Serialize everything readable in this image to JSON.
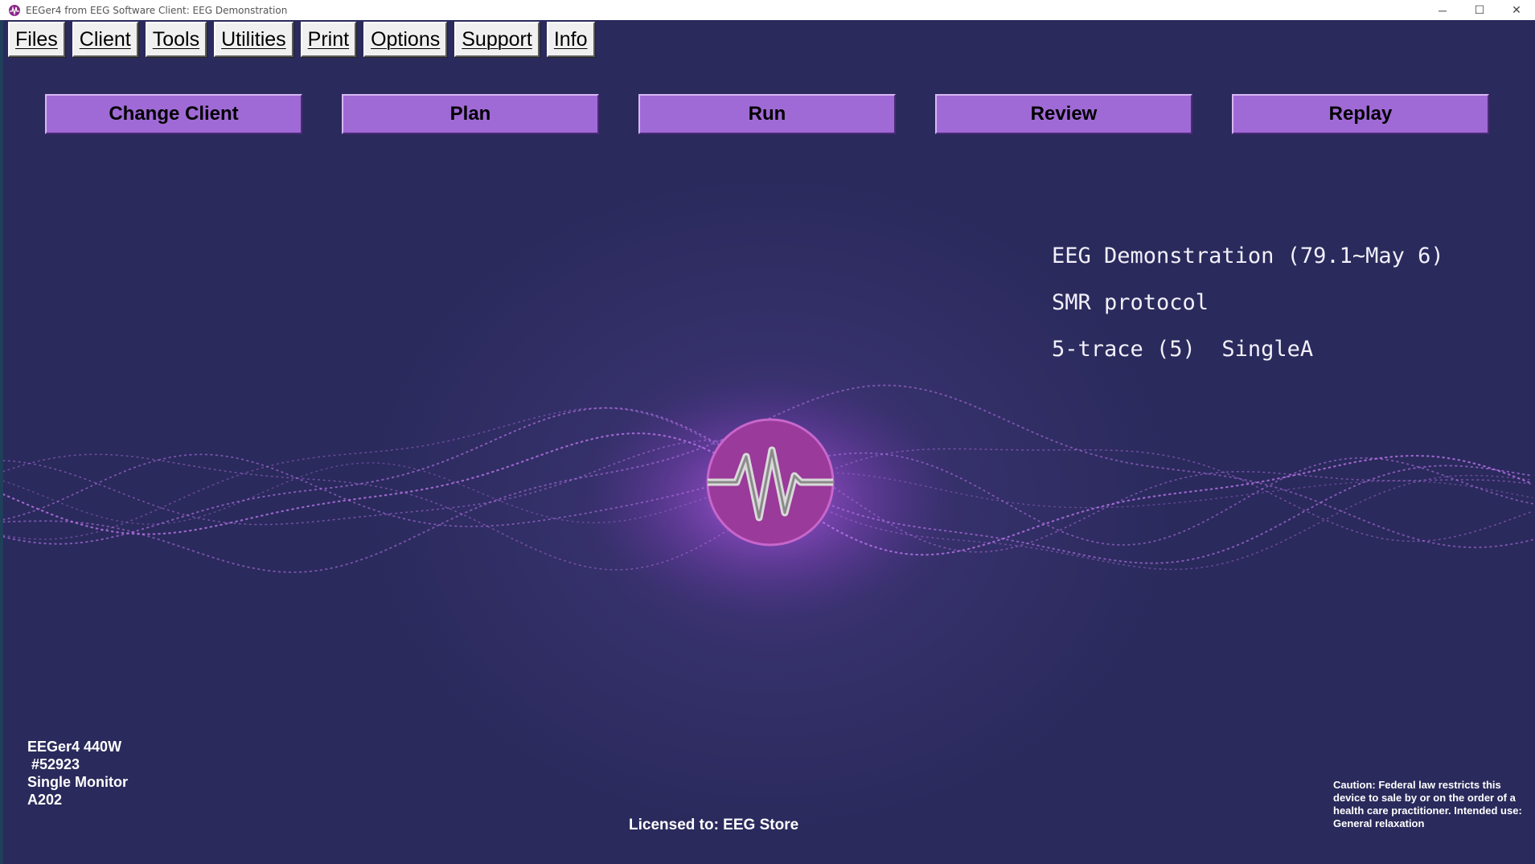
{
  "window": {
    "title": "EEGer4 from EEG Software  Client: EEG Demonstration",
    "minimize": "─",
    "maximize": "☐",
    "close": "✕"
  },
  "menu": [
    "Files",
    "Client",
    "Tools",
    "Utilities",
    "Print",
    "Options",
    "Support",
    "Info"
  ],
  "actions": [
    "Change Client",
    "Plan",
    "Run",
    "Review",
    "Replay"
  ],
  "session": {
    "client_line": "EEG Demonstration (79.1~May 6)",
    "protocol_line": "SMR protocol",
    "display_line": "5-trace (5)  SingleA"
  },
  "product": {
    "name": "EEGer4 440W",
    "serial": " #52923",
    "monitor": "Single Monitor",
    "code": "A202"
  },
  "licensed": "Licensed to: EEG Store",
  "caution": "Caution: Federal law restricts this device to sale by or on the order of a health care practitioner. Intended use: General relaxation",
  "colors": {
    "background": "#2a2a5c",
    "button": "#a06ad6",
    "wave": "#b86ae8",
    "logo": "#9a3a9a"
  },
  "icons": {
    "app": "eeger-app-icon",
    "logo": "eeg-wave-logo"
  }
}
